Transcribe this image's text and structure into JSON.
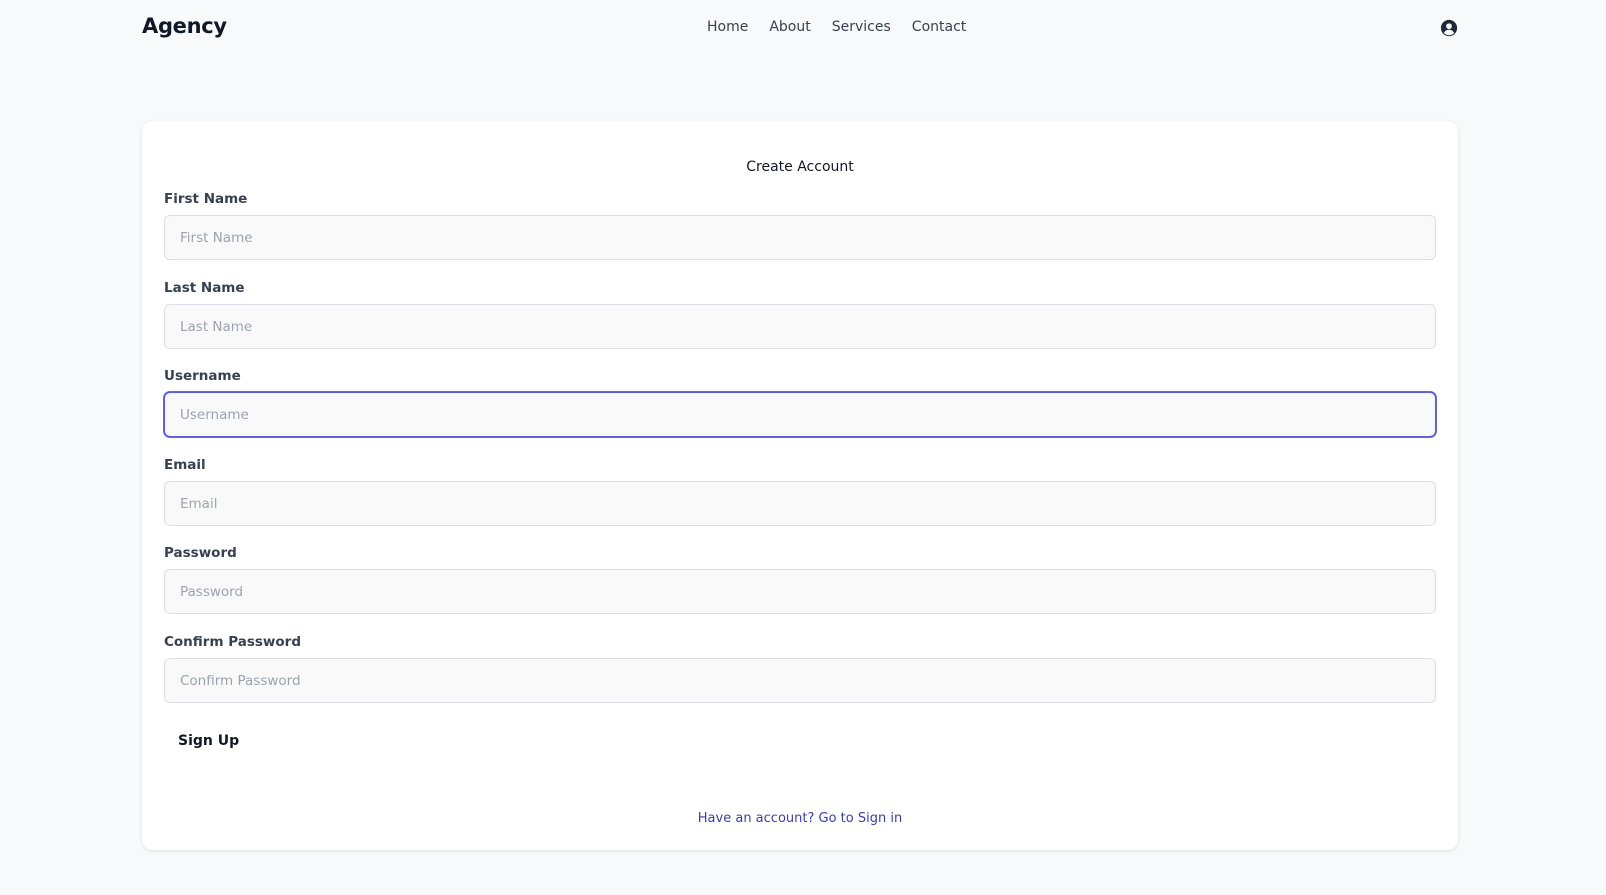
{
  "nav": {
    "brand": "Agency",
    "links": [
      "Home",
      "About",
      "Services",
      "Contact"
    ]
  },
  "form": {
    "title": "Create Account",
    "fields": [
      {
        "label": "First Name",
        "placeholder": "First Name",
        "value": ""
      },
      {
        "label": "Last Name",
        "placeholder": "Last Name",
        "value": ""
      },
      {
        "label": "Username",
        "placeholder": "Username",
        "value": "",
        "focused": true
      },
      {
        "label": "Email",
        "placeholder": "Email",
        "value": ""
      },
      {
        "label": "Password",
        "placeholder": "Password",
        "value": ""
      },
      {
        "label": "Confirm Password",
        "placeholder": "Confirm Password",
        "value": ""
      }
    ],
    "submit_label": "Sign Up",
    "signin_link": "Have an account? Go to Sign in"
  },
  "icons": {
    "user": "user-circle-icon"
  },
  "colors": {
    "focus_border": "#5b5bd6",
    "link": "#3b3fa8",
    "background": "#f8f9fb"
  }
}
